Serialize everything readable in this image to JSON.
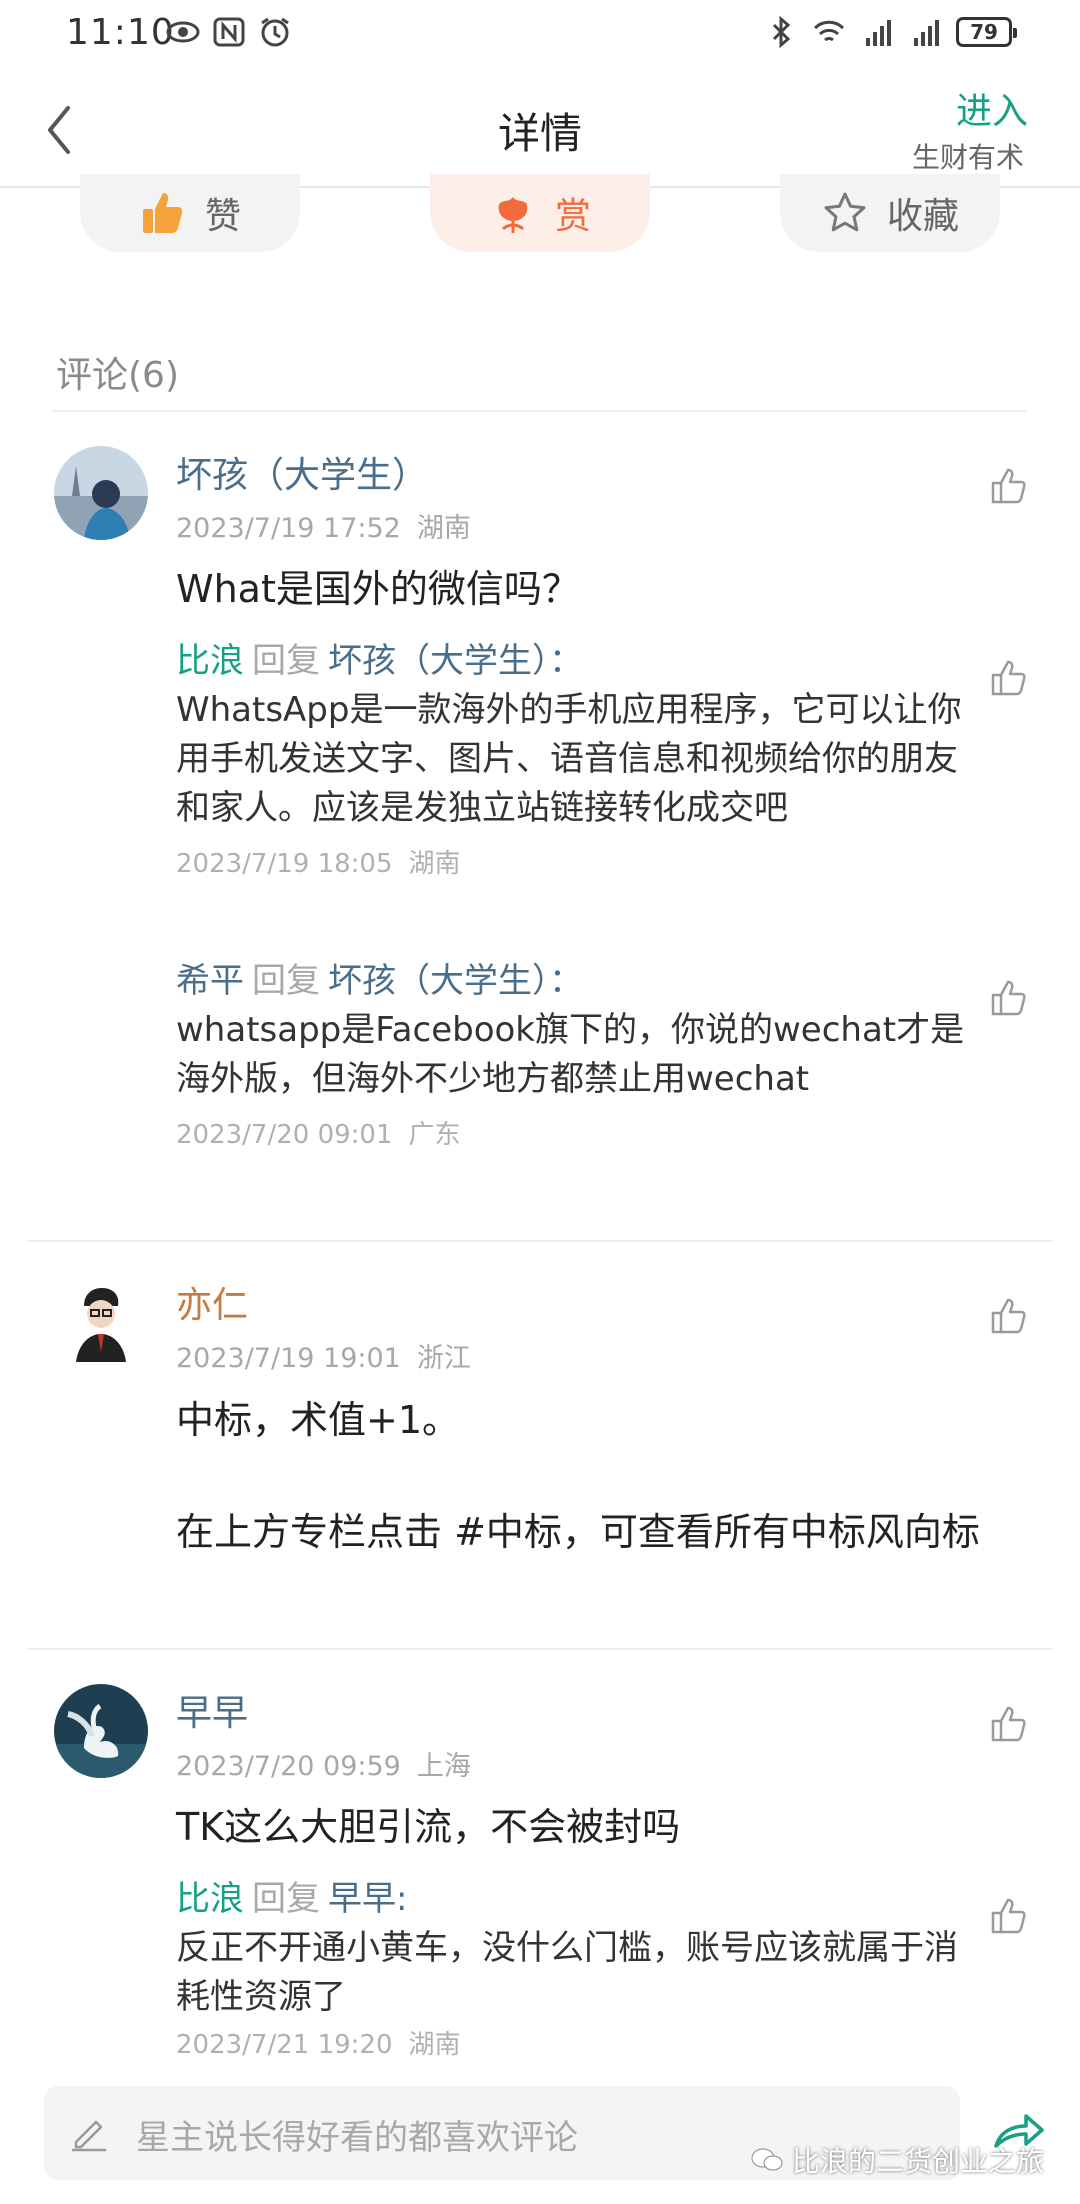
{
  "status_bar": {
    "time": "11:10",
    "battery": "79"
  },
  "nav": {
    "title": "详情",
    "enter": "进入",
    "sub": "生财有术"
  },
  "actions": {
    "like": "赞",
    "reward": "赏",
    "favorite": "收藏"
  },
  "comments_header": "评论(6)",
  "comments": [
    {
      "name": "坏孩（大学生）",
      "date": "2023/7/19 17:52",
      "location": "湖南",
      "body": "What是国外的微信吗？",
      "replies": [
        {
          "from": "比浪",
          "verb": "回复",
          "to": "坏孩（大学生）",
          "colon": "：",
          "text": "WhatsApp是一款海外的手机应用程序，它可以让你用手机发送文字、图片、语音信息和视频给你的朋友和家人。应该是发独立站链接转化成交吧",
          "date": "2023/7/19 18:05",
          "location": "湖南"
        },
        {
          "from": "希平",
          "verb": "回复",
          "to": "坏孩（大学生）",
          "colon": "：",
          "text": "whatsapp是Facebook旗下的，你说的wechat才是海外版，但海外不少地方都禁止用wechat",
          "date": "2023/7/20 09:01",
          "location": "广东"
        }
      ]
    },
    {
      "name": "亦仁",
      "date": "2023/7/19 19:01",
      "location": "浙江",
      "body": "中标，术值+1。\n\n在上方专栏点击 #中标，可查看所有中标风向标"
    },
    {
      "name": "早早",
      "date": "2023/7/20 09:59",
      "location": "上海",
      "body": "TK这么大胆引流，不会被封吗",
      "replies": [
        {
          "from": "比浪",
          "verb": "回复",
          "to": "早早",
          "colon": ":",
          "text": "反正不开通小黄车，没什么门槛，账号应该就属于消耗性资源了",
          "date": "2023/7/21 19:20",
          "location": "湖南"
        }
      ]
    }
  ],
  "input": {
    "placeholder": "星主说长得好看的都喜欢评论"
  },
  "watermark": "比浪的二货创业之旅",
  "colors": {
    "accent_green": "#16a085",
    "name_blue": "#4a6e8a",
    "name_orange": "#c57a3f",
    "reward_orange": "#f26a3d"
  }
}
